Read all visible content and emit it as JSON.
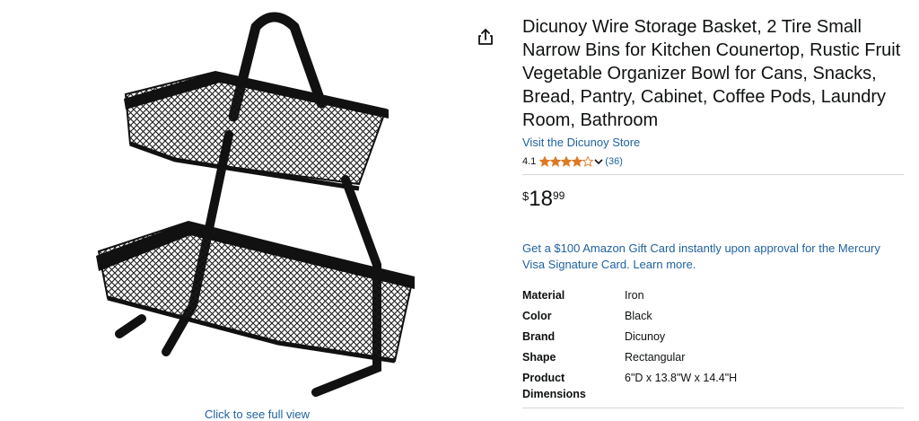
{
  "product": {
    "title": "Dicunoy Wire Storage Basket, 2 Tire Small Narrow Bins for Kitchen Counertop, Rustic Fruit Vegetable Organizer Bowl for Cans, Snacks, Bread, Pantry, Cabinet, Coffee Pods, Laundry Room, Bathroom",
    "store_link": "Visit the Dicunoy Store",
    "rating": "4.1",
    "rating_value": 4.1,
    "review_count": "(36)",
    "price": {
      "symbol": "$",
      "whole": "18",
      "fraction": "99"
    },
    "offer_text": "Get a $100 Amazon Gift Card instantly upon approval for the Mercury Visa Signature Card. Learn more.",
    "specs": [
      {
        "key": "Material",
        "value": "Iron"
      },
      {
        "key": "Color",
        "value": "Black"
      },
      {
        "key": "Brand",
        "value": "Dicunoy"
      },
      {
        "key": "Shape",
        "value": "Rectangular"
      },
      {
        "key": "Product Dimensions",
        "value": "6\"D x 13.8\"W x 14.4\"H"
      }
    ]
  },
  "image": {
    "click_text": "Click to see full view"
  },
  "icons": {
    "share": "share-icon",
    "star": "star-icon",
    "chevron": "chevron-down-icon"
  },
  "colors": {
    "link": "#2162A1",
    "star": "#DE7921",
    "text": "#0F1111"
  }
}
